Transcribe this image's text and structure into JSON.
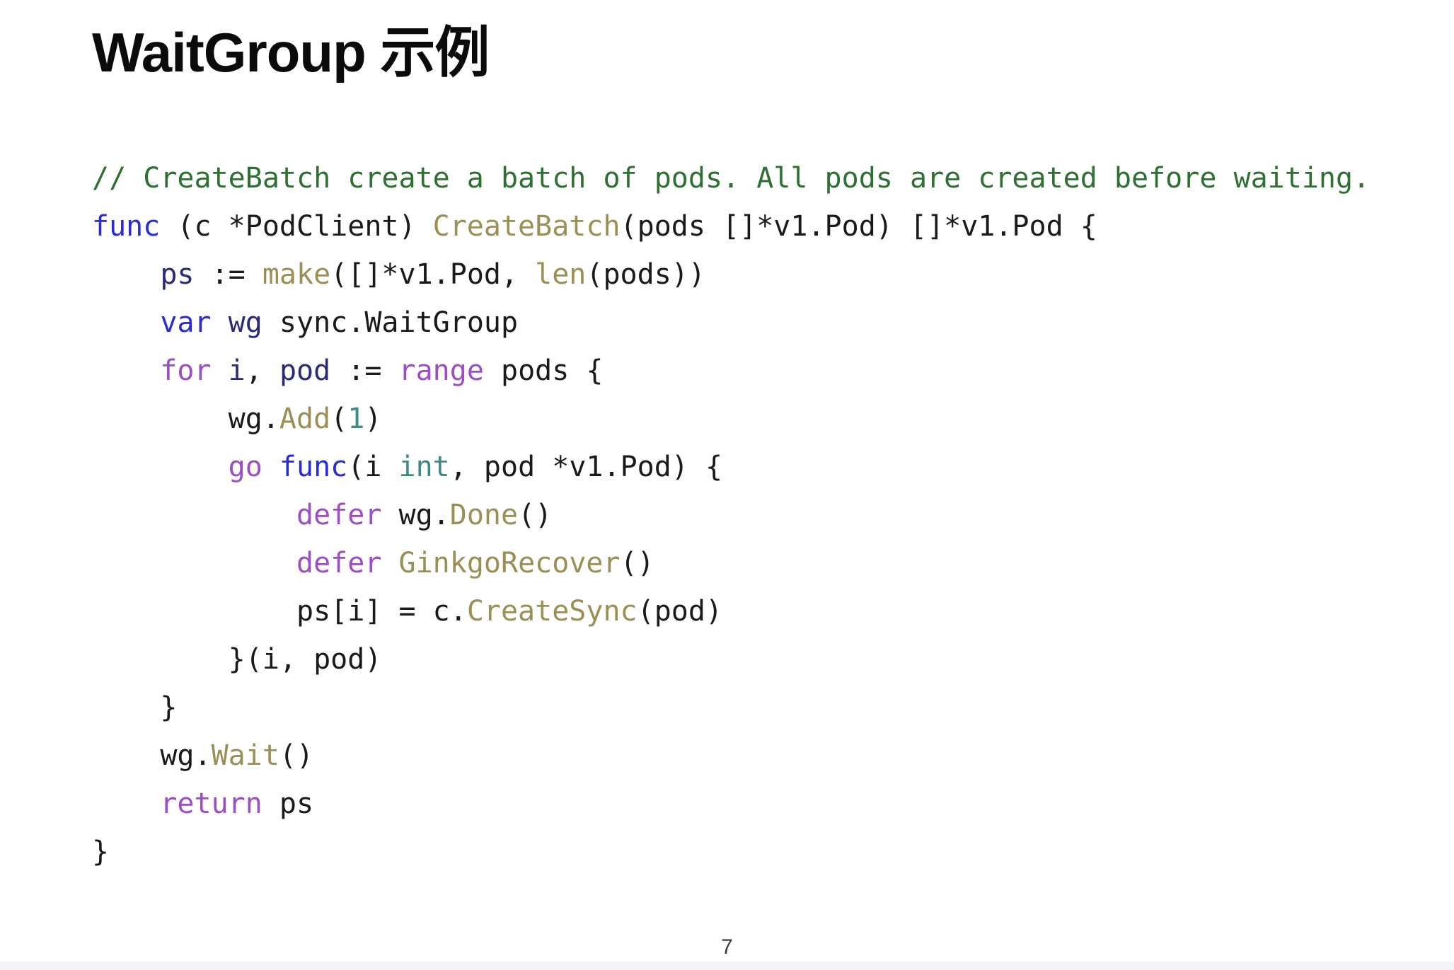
{
  "slide": {
    "title": "WaitGroup 示例",
    "page_number": "7",
    "background_color": "#ffffff"
  },
  "theme": {
    "comment_color": "#2e7031",
    "keyword_blue": "#2b2bd4",
    "keyword_purple": "#9a4fc4",
    "function_color": "#9a9055",
    "variable_color": "#2a2a7a",
    "type_color": "#3f8a85",
    "number_color": "#3f8a85",
    "plain_color": "#1a1a1a"
  },
  "code": {
    "language": "go",
    "lines": [
      {
        "id": "l1",
        "text": "// CreateBatch create a batch of pods. All pods are created before waiting."
      },
      {
        "id": "l2",
        "text": "func (c *PodClient) CreateBatch(pods []*v1.Pod) []*v1.Pod {"
      },
      {
        "id": "l3",
        "text": "    ps := make([]*v1.Pod, len(pods))"
      },
      {
        "id": "l4",
        "text": "    var wg sync.WaitGroup"
      },
      {
        "id": "l5",
        "text": "    for i, pod := range pods {"
      },
      {
        "id": "l6",
        "text": "        wg.Add(1)"
      },
      {
        "id": "l7",
        "text": "        go func(i int, pod *v1.Pod) {"
      },
      {
        "id": "l8",
        "text": "            defer wg.Done()"
      },
      {
        "id": "l9",
        "text": "            defer GinkgoRecover()"
      },
      {
        "id": "l10",
        "text": "            ps[i] = c.CreateSync(pod)"
      },
      {
        "id": "l11",
        "text": "        }(i, pod)"
      },
      {
        "id": "l12",
        "text": "    }"
      },
      {
        "id": "l13",
        "text": "    wg.Wait()"
      },
      {
        "id": "l14",
        "text": "    return ps"
      },
      {
        "id": "l15",
        "text": "}"
      }
    ],
    "tokens": {
      "l1": [
        {
          "t": "// CreateBatch create a batch of pods. All pods are created before waiting.",
          "c": "tok-comment"
        }
      ],
      "l2": [
        {
          "t": "func",
          "c": "tok-kw-blue"
        },
        {
          "t": " (c ",
          "c": "tok-plain"
        },
        {
          "t": "*PodClient) ",
          "c": "tok-plain"
        },
        {
          "t": "CreateBatch",
          "c": "tok-func"
        },
        {
          "t": "(pods []*v1.Pod) []*v1.Pod {",
          "c": "tok-plain"
        }
      ],
      "l3": [
        {
          "t": "    ",
          "c": "tok-plain"
        },
        {
          "t": "ps",
          "c": "tok-var"
        },
        {
          "t": " := ",
          "c": "tok-plain"
        },
        {
          "t": "make",
          "c": "tok-func"
        },
        {
          "t": "([]*v1.Pod, ",
          "c": "tok-plain"
        },
        {
          "t": "len",
          "c": "tok-func"
        },
        {
          "t": "(pods))",
          "c": "tok-plain"
        }
      ],
      "l4": [
        {
          "t": "    ",
          "c": "tok-plain"
        },
        {
          "t": "var",
          "c": "tok-kw-blue"
        },
        {
          "t": " ",
          "c": "tok-plain"
        },
        {
          "t": "wg",
          "c": "tok-var"
        },
        {
          "t": " sync.WaitGroup",
          "c": "tok-plain"
        }
      ],
      "l5": [
        {
          "t": "    ",
          "c": "tok-plain"
        },
        {
          "t": "for",
          "c": "tok-kw-purple"
        },
        {
          "t": " ",
          "c": "tok-plain"
        },
        {
          "t": "i",
          "c": "tok-var"
        },
        {
          "t": ", ",
          "c": "tok-plain"
        },
        {
          "t": "pod",
          "c": "tok-var"
        },
        {
          "t": " := ",
          "c": "tok-plain"
        },
        {
          "t": "range",
          "c": "tok-kw-purple"
        },
        {
          "t": " pods {",
          "c": "tok-plain"
        }
      ],
      "l6": [
        {
          "t": "        wg.",
          "c": "tok-plain"
        },
        {
          "t": "Add",
          "c": "tok-func"
        },
        {
          "t": "(",
          "c": "tok-plain"
        },
        {
          "t": "1",
          "c": "tok-num"
        },
        {
          "t": ")",
          "c": "tok-plain"
        }
      ],
      "l7": [
        {
          "t": "        ",
          "c": "tok-plain"
        },
        {
          "t": "go",
          "c": "tok-kw-purple"
        },
        {
          "t": " ",
          "c": "tok-plain"
        },
        {
          "t": "func",
          "c": "tok-kw-blue"
        },
        {
          "t": "(i ",
          "c": "tok-plain"
        },
        {
          "t": "int",
          "c": "tok-type"
        },
        {
          "t": ", pod *v1.Pod) {",
          "c": "tok-plain"
        }
      ],
      "l8": [
        {
          "t": "            ",
          "c": "tok-plain"
        },
        {
          "t": "defer",
          "c": "tok-kw-purple"
        },
        {
          "t": " wg.",
          "c": "tok-plain"
        },
        {
          "t": "Done",
          "c": "tok-func"
        },
        {
          "t": "()",
          "c": "tok-plain"
        }
      ],
      "l9": [
        {
          "t": "            ",
          "c": "tok-plain"
        },
        {
          "t": "defer",
          "c": "tok-kw-purple"
        },
        {
          "t": " ",
          "c": "tok-plain"
        },
        {
          "t": "GinkgoRecover",
          "c": "tok-func"
        },
        {
          "t": "()",
          "c": "tok-plain"
        }
      ],
      "l10": [
        {
          "t": "            ps[i] = c.",
          "c": "tok-plain"
        },
        {
          "t": "CreateSync",
          "c": "tok-func"
        },
        {
          "t": "(pod)",
          "c": "tok-plain"
        }
      ],
      "l11": [
        {
          "t": "        }(i, pod)",
          "c": "tok-plain"
        }
      ],
      "l12": [
        {
          "t": "    }",
          "c": "tok-plain"
        }
      ],
      "l13": [
        {
          "t": "    wg.",
          "c": "tok-plain"
        },
        {
          "t": "Wait",
          "c": "tok-func"
        },
        {
          "t": "()",
          "c": "tok-plain"
        }
      ],
      "l14": [
        {
          "t": "    ",
          "c": "tok-plain"
        },
        {
          "t": "return",
          "c": "tok-kw-purple"
        },
        {
          "t": " ps",
          "c": "tok-plain"
        }
      ],
      "l15": [
        {
          "t": "}",
          "c": "tok-plain"
        }
      ]
    }
  }
}
